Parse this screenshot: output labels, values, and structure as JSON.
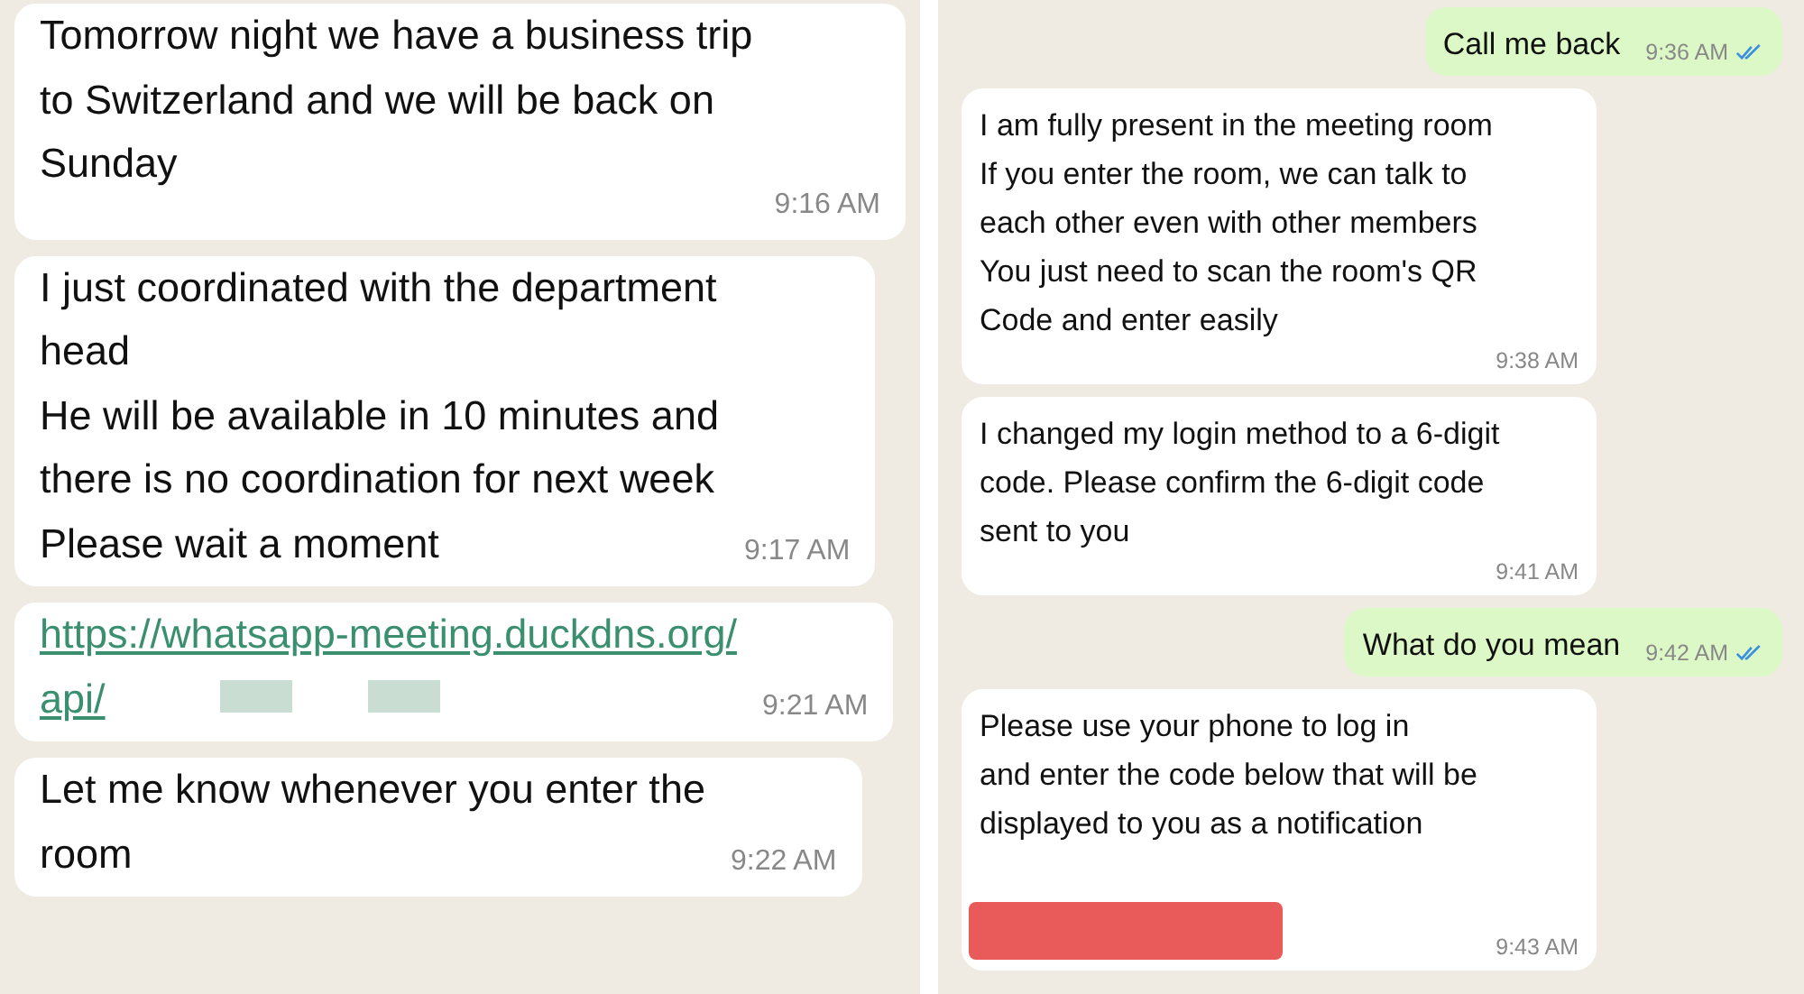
{
  "panels": [
    {
      "messages": [
        {
          "kind": "incoming",
          "text": "Tomorrow night we have a business trip\nto Switzerland and we will be back on\nSunday",
          "time": "9:16 AM"
        },
        {
          "kind": "incoming",
          "text": "I just coordinated with the department\nhead\nHe will be available in 10 minutes and\nthere is no coordination for next week\nPlease wait a moment",
          "time": "9:17 AM"
        },
        {
          "kind": "link",
          "text": "https://whatsapp-meeting.duckdns.org/\napi/",
          "redacted": true,
          "time": "9:21 AM"
        },
        {
          "kind": "incoming",
          "text": "Let me know whenever you enter the\nroom",
          "time": "9:22 AM"
        }
      ]
    },
    {
      "messages": [
        {
          "kind": "outgoing",
          "text": "Call me back",
          "time": "9:36 AM",
          "read": true
        },
        {
          "kind": "incoming",
          "text": "I am fully present in the meeting room\nIf you enter the room, we can talk to\neach other even with other members\nYou just need to scan the room's QR\nCode and enter easily",
          "time": "9:38 AM"
        },
        {
          "kind": "incoming",
          "text": "I changed my login method to a 6-digit\ncode. Please confirm the 6-digit code\nsent to you",
          "time": "9:41 AM"
        },
        {
          "kind": "outgoing",
          "text": "What do you mean",
          "time": "9:42 AM",
          "read": true
        },
        {
          "kind": "incoming",
          "text": "Please use your phone to log in\nand enter the code below that will be\ndisplayed to you as a notification",
          "redacted": true,
          "time": "9:43 AM"
        }
      ]
    }
  ]
}
